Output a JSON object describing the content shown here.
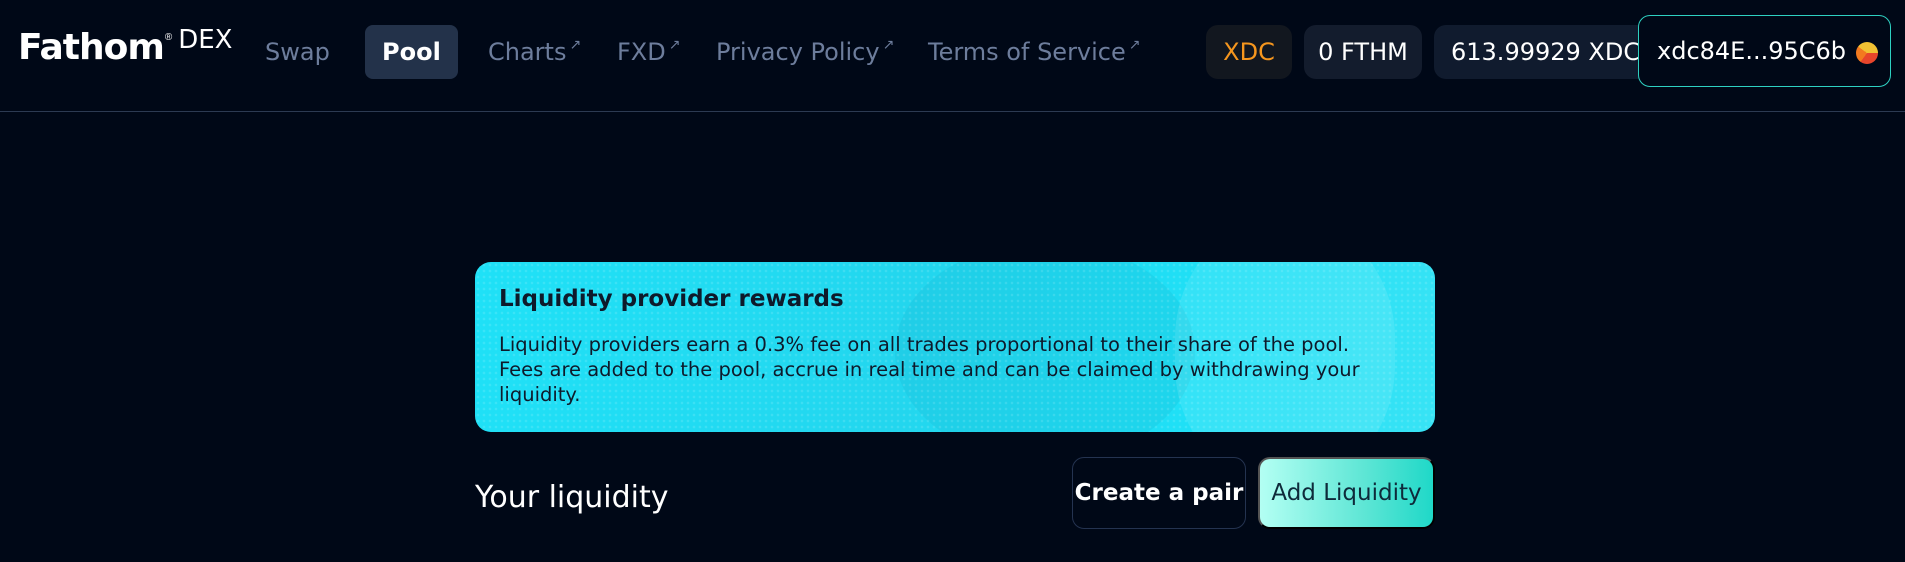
{
  "header": {
    "logo": {
      "name": "Fathom",
      "trademark": "®",
      "product": "DEX"
    },
    "nav": [
      {
        "label": "Swap",
        "external": false,
        "active": false
      },
      {
        "label": "Pool",
        "external": false,
        "active": true
      },
      {
        "label": "Charts",
        "external": true,
        "active": false
      },
      {
        "label": "FXD",
        "external": true,
        "active": false
      },
      {
        "label": "Privacy Policy",
        "external": true,
        "active": false
      },
      {
        "label": "Terms of Service",
        "external": true,
        "active": false
      }
    ],
    "external_glyph": "↗",
    "network": "XDC",
    "fthm_balance": "0 FTHM",
    "xdc_balance": "613.99929 XDC",
    "wallet_address": "xdc84E...95C6b"
  },
  "banner": {
    "title": "Liquidity provider rewards",
    "body": "Liquidity providers earn a 0.3% fee on all trades proportional to their share of the pool. Fees are added to the pool, accrue in real time and can be claimed by withdrawing your liquidity."
  },
  "liquidity": {
    "title": "Your liquidity",
    "create_pair_label": "Create a pair",
    "add_liquidity_label": "Add Liquidity"
  },
  "colors": {
    "background": "#000817",
    "accent_teal": "#2ed1c2",
    "banner_cyan": "#1fe1f7",
    "network_orange": "#f5961e",
    "nav_inactive": "#6d7d9c"
  },
  "icons": [
    "external-link-icon",
    "wallet-avatar-icon"
  ]
}
